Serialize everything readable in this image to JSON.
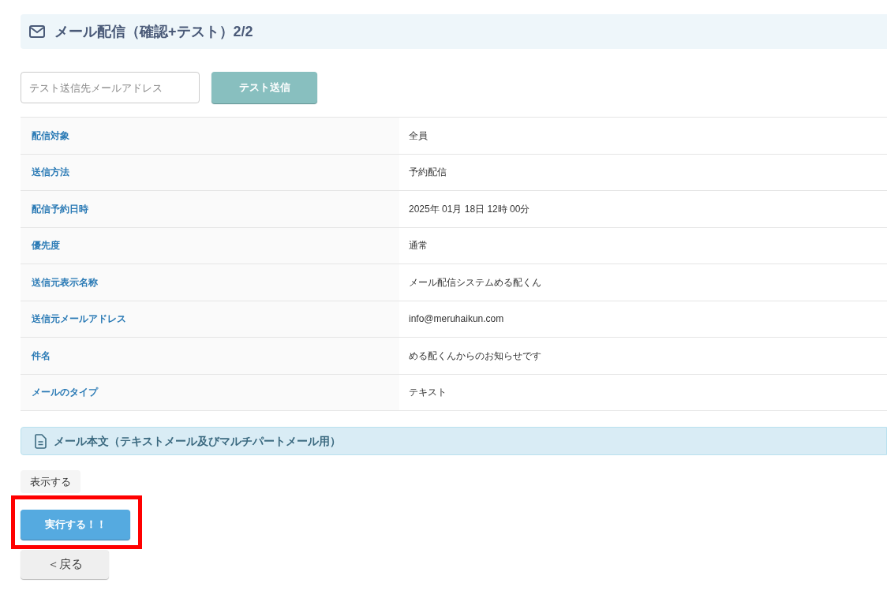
{
  "header": {
    "title": "メール配信（確認+テスト）2/2"
  },
  "test_send": {
    "placeholder": "テスト送信先メールアドレス",
    "button": "テスト送信"
  },
  "details": [
    {
      "label": "配信対象",
      "value": "全員"
    },
    {
      "label": "送信方法",
      "value": "予約配信"
    },
    {
      "label": "配信予約日時",
      "value": "2025年 01月 18日 12時 00分"
    },
    {
      "label": "優先度",
      "value": "通常"
    },
    {
      "label": "送信元表示名称",
      "value": "メール配信システムめる配くん"
    },
    {
      "label": "送信元メールアドレス",
      "value": "info@meruhaikun.com"
    },
    {
      "label": "件名",
      "value": "める配くんからのお知らせです"
    },
    {
      "label": "メールのタイプ",
      "value": "テキスト"
    }
  ],
  "body_section": {
    "title": "メール本文（テキストメール及びマルチパートメール用）",
    "show_button": "表示する"
  },
  "execute_button": "実行する！！",
  "back_button": "＜戻る"
}
